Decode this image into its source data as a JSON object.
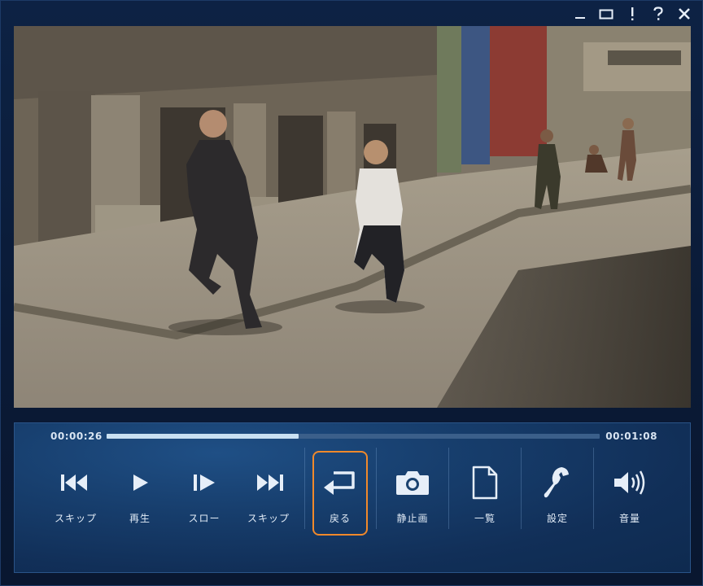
{
  "window": {
    "controls": {
      "minimize": "_",
      "maximize": "□",
      "info": "!",
      "help": "?",
      "close": "✕"
    }
  },
  "player": {
    "current_time": "00:00:26",
    "duration": "00:01:08",
    "progress_fraction": 0.39,
    "accent_color": "#f0892b"
  },
  "controls": [
    {
      "label": "スキップ",
      "icon": "skip-back-icon"
    },
    {
      "label": "再生",
      "icon": "play-icon"
    },
    {
      "label": "スロー",
      "icon": "slow-icon"
    },
    {
      "label": "スキップ",
      "icon": "skip-forward-icon"
    },
    {
      "label": "戻る",
      "icon": "return-icon",
      "selected": true
    },
    {
      "label": "静止画",
      "icon": "camera-icon"
    },
    {
      "label": "一覧",
      "icon": "document-icon"
    },
    {
      "label": "設定",
      "icon": "wrench-icon"
    },
    {
      "label": "音量",
      "icon": "volume-icon"
    }
  ]
}
